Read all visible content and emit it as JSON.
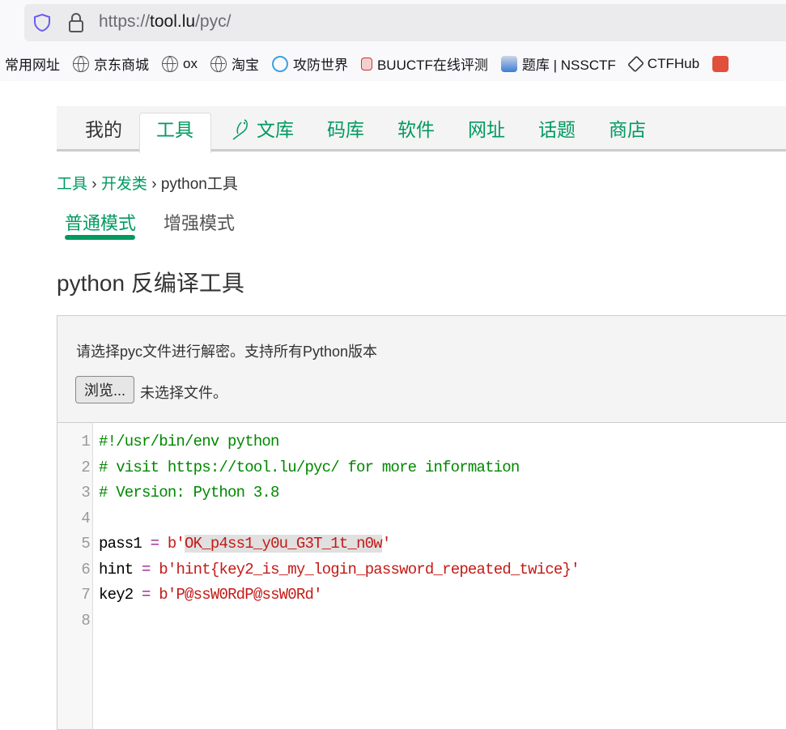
{
  "browser": {
    "url_prefix": "https://",
    "url_domain": "tool.lu",
    "url_path": "/pyc/",
    "bookmarks": [
      {
        "label": "常用网址",
        "icon": "none"
      },
      {
        "label": "京东商城",
        "icon": "globe-icon"
      },
      {
        "label": "ox",
        "icon": "globe-icon"
      },
      {
        "label": "淘宝",
        "icon": "globe-icon"
      },
      {
        "label": "攻防世界",
        "icon": "adworld-icon"
      },
      {
        "label": "BUUCTF在线评测",
        "icon": "buuctf-icon"
      },
      {
        "label": "题库 | NSSCTF",
        "icon": "nssctf-icon"
      },
      {
        "label": "CTFHub",
        "icon": "ctfhub-icon"
      }
    ]
  },
  "nav": {
    "tabs": [
      "我的",
      "工具",
      "文库",
      "码库",
      "软件",
      "网址",
      "话题",
      "商店"
    ],
    "active": "工具"
  },
  "breadcrumb": [
    "工具",
    "开发类",
    "python工具"
  ],
  "modes": [
    "普通模式",
    "增强模式"
  ],
  "title": "python 反编译工具",
  "upload": {
    "hint": "请选择pyc文件进行解密。支持所有Python版本",
    "browse_label": "浏览...",
    "no_file": "未选择文件。"
  },
  "code": {
    "lines": [
      {
        "n": "1",
        "a": "#!/usr/bin/env python"
      },
      {
        "n": "2",
        "a": "# visit https://tool.lu/pyc/ for more information"
      },
      {
        "n": "3",
        "a": "# Version: Python 3.8"
      },
      {
        "n": "4"
      },
      {
        "n": "5",
        "var": "pass1",
        "op": " = ",
        "pre": "b'",
        "str": "OK_p4ss1_y0u_G3T_1t_n0w",
        "post": "'"
      },
      {
        "n": "6",
        "var": "hint",
        "op": " = ",
        "pre": "b'",
        "str": "hint{key2_is_my_login_password_repeated_twice}",
        "post": "'"
      },
      {
        "n": "7",
        "var": "key2",
        "op": " = ",
        "pre": "b'",
        "str": "P@ssW0RdP@ssW0Rd",
        "post": "'"
      },
      {
        "n": "8"
      }
    ]
  },
  "colors": {
    "accent": "#009a61",
    "comment": "#008800",
    "string": "#c41a16"
  }
}
